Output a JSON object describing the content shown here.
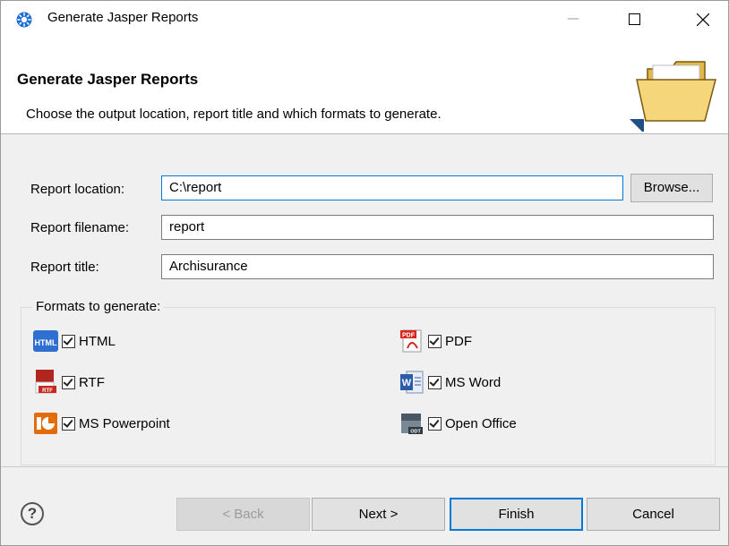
{
  "window": {
    "title": "Generate Jasper Reports",
    "app_icon": "gear-blue-icon"
  },
  "banner": {
    "title": "Generate Jasper Reports",
    "description": "Choose the output location, report title and which formats to generate."
  },
  "form": {
    "location_label": "Report location:",
    "location_value": "C:\\report",
    "browse_label": "Browse...",
    "filename_label": "Report filename:",
    "filename_value": "report",
    "title_label": "Report title:",
    "title_value": "Archisurance"
  },
  "formats": {
    "legend": "Formats to generate:",
    "items": [
      {
        "label": "HTML",
        "checked": true,
        "icon": "html-icon"
      },
      {
        "label": "PDF",
        "checked": true,
        "icon": "pdf-icon"
      },
      {
        "label": "RTF",
        "checked": true,
        "icon": "rtf-icon"
      },
      {
        "label": "MS Word",
        "checked": true,
        "icon": "ms-word-icon"
      },
      {
        "label": "MS Powerpoint",
        "checked": true,
        "icon": "ms-powerpoint-icon"
      },
      {
        "label": "Open Office",
        "checked": true,
        "icon": "open-office-icon"
      }
    ]
  },
  "buttons": {
    "back": "< Back",
    "next": "Next >",
    "finish": "Finish",
    "cancel": "Cancel"
  },
  "colors": {
    "accent": "#0078d7"
  }
}
